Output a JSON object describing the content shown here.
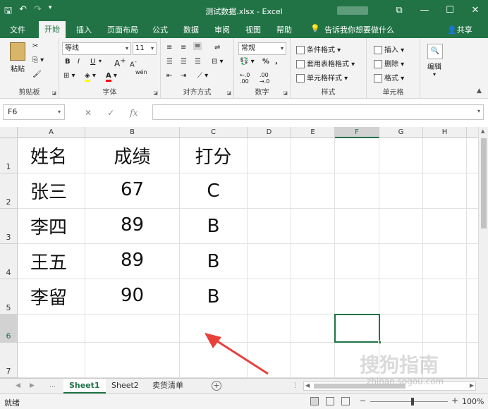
{
  "window": {
    "title": "测试数据.xlsx  -  Excel",
    "controls": [
      "restore-icon",
      "minimize-icon",
      "maximize-icon",
      "close-icon"
    ]
  },
  "tabs": [
    "文件",
    "开始",
    "插入",
    "页面布局",
    "公式",
    "数据",
    "审阅",
    "视图",
    "帮助"
  ],
  "active_tab": "开始",
  "tellme": "告诉我你想要做什么",
  "share": "共享",
  "ribbon": {
    "clipboard": {
      "label": "剪贴板",
      "paste": "粘贴"
    },
    "font": {
      "label": "字体",
      "font_name": "等线",
      "font_size": "11",
      "bold": "B",
      "italic": "I",
      "underline": "U",
      "wen": "wén"
    },
    "alignment": {
      "label": "对齐方式"
    },
    "number": {
      "label": "数字",
      "format": "常规",
      "percent": "%"
    },
    "styles": {
      "label": "样式",
      "conditional": "条件格式",
      "table": "套用表格格式",
      "cell": "单元格样式"
    },
    "cells": {
      "label": "单元格",
      "insert": "插入",
      "delete": "删除",
      "format": "格式"
    },
    "editing": {
      "label": "编辑"
    }
  },
  "formula_bar": {
    "name_box": "F6",
    "fx": "fx",
    "value": ""
  },
  "columns": [
    "A",
    "B",
    "C",
    "D",
    "E",
    "F",
    "G",
    "H"
  ],
  "selected_column": "F",
  "rows": [
    "1",
    "2",
    "3",
    "4",
    "5",
    "6",
    "7"
  ],
  "table": {
    "header": [
      "姓名",
      "成绩",
      "打分"
    ],
    "data": [
      [
        "张三",
        "67",
        "C"
      ],
      [
        "李四",
        "89",
        "B"
      ],
      [
        "王五",
        "89",
        "B"
      ],
      [
        "李留",
        "90",
        "B"
      ]
    ]
  },
  "active_cell": "F6",
  "sheets": [
    "Sheet1",
    "Sheet2",
    "卖货清单"
  ],
  "active_sheet": "Sheet1",
  "status": {
    "ready": "就绪",
    "zoom": "100%"
  },
  "watermark": {
    "text": "搜狗指南",
    "url": "zhinan.sogou.com"
  },
  "accent_color": "#217346",
  "annotation_color": "#e8413b"
}
